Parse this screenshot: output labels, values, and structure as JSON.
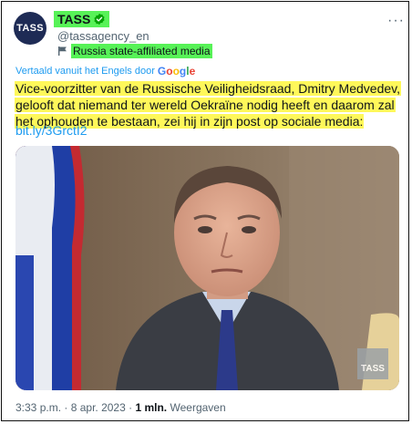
{
  "account": {
    "avatar_text": "TASS",
    "name": "TASS",
    "handle": "@tassagency_en",
    "affiliation": "Russia state-affiliated media",
    "verified_color": "#00a300"
  },
  "menu_icon": "more-icon",
  "translation": {
    "label": "Vertaald vanuit het Engels door",
    "provider": "Google"
  },
  "tweet": {
    "text": "Vice-voorzitter van de Russische Veiligheidsraad, Dmitry Medvedev, gelooft dat niemand ter wereld Oekraïne nodig heeft en daarom zal het ophouden te bestaan, zei hij in zijn post op sociale media:",
    "link": "bit.ly/3GrctI2"
  },
  "photo": {
    "watermark": "TASS"
  },
  "meta": {
    "time": "3:33 p.m.",
    "sep1": "·",
    "date": "8 apr. 2023",
    "sep2": "·",
    "views_count": "1 mln.",
    "views_label": "Weergaven"
  },
  "colors": {
    "highlight_green": "#57f257",
    "highlight_yellow": "#fff85a",
    "link_blue": "#1d9bf0"
  }
}
